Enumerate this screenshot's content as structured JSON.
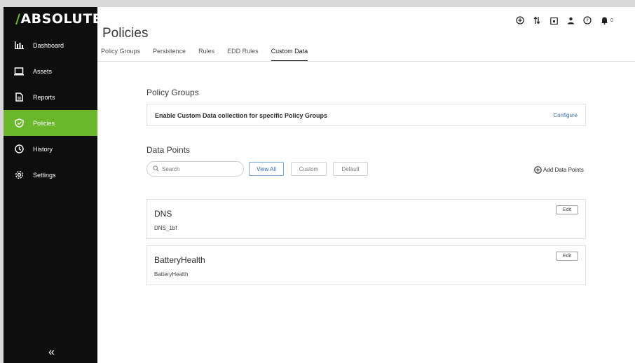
{
  "brand": {
    "logo_slash": "/",
    "logo_text": "ABSOLUTE"
  },
  "sidebar": {
    "items": [
      {
        "label": "Dashboard",
        "icon": "bar-chart-icon"
      },
      {
        "label": "Assets",
        "icon": "laptop-icon"
      },
      {
        "label": "Reports",
        "icon": "document-icon"
      },
      {
        "label": "Policies",
        "icon": "shield-icon",
        "active": true
      },
      {
        "label": "History",
        "icon": "clock-icon"
      },
      {
        "label": "Settings",
        "icon": "gear-icon"
      }
    ],
    "collapse_glyph": "«"
  },
  "header": {
    "title": "Policies",
    "tabs": [
      {
        "label": "Policy Groups"
      },
      {
        "label": "Persistence"
      },
      {
        "label": "Rules"
      },
      {
        "label": "EDD Rules"
      },
      {
        "label": "Custom Data",
        "active": true
      }
    ],
    "top_icons": [
      "add-circle-icon",
      "transfer-icon",
      "calendar-icon",
      "user-icon",
      "help-icon",
      "bell-icon"
    ],
    "notification_count": "0"
  },
  "policy_groups": {
    "title": "Policy Groups",
    "description": "Enable Custom Data collection for specific Policy Groups",
    "configure_label": "Configure"
  },
  "data_points": {
    "title": "Data Points",
    "search_placeholder": "Search",
    "filters": [
      {
        "label": "View All",
        "active": true
      },
      {
        "label": "Custom"
      },
      {
        "label": "Default"
      }
    ],
    "add_label": "Add Data Points",
    "items": [
      {
        "name": "DNS",
        "sub": "DNS_1bf",
        "edit_label": "Edit"
      },
      {
        "name": "BatteryHealth",
        "sub": "BatteryHealth",
        "edit_label": "Edit"
      }
    ]
  },
  "colors": {
    "accent": "#6ab72b",
    "sidebar_bg": "#0e0e0e",
    "link": "#3b6ea5"
  }
}
